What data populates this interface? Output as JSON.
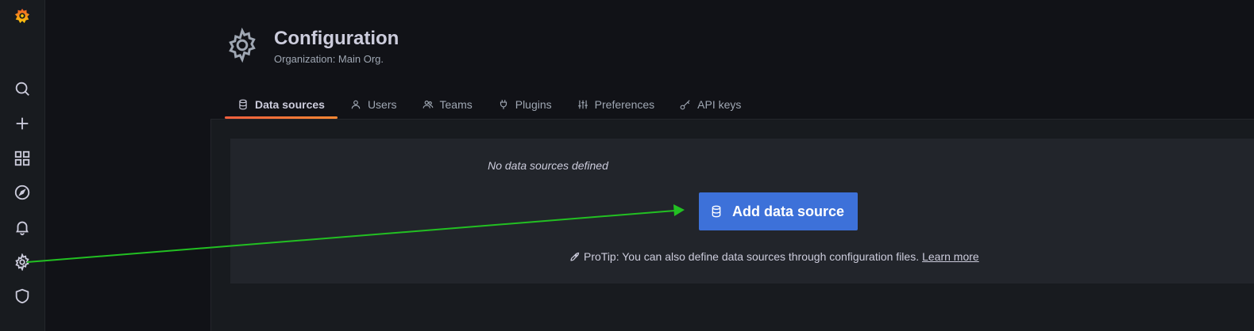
{
  "header": {
    "title": "Configuration",
    "subtitle": "Organization: Main Org."
  },
  "sidemenu": {
    "items": [
      {
        "icon": "grafana-logo-icon"
      },
      {
        "icon": "search-icon"
      },
      {
        "icon": "plus-icon"
      },
      {
        "icon": "dashboards-icon"
      },
      {
        "icon": "explore-compass-icon"
      },
      {
        "icon": "alerting-bell-icon"
      },
      {
        "icon": "configuration-gear-icon"
      },
      {
        "icon": "server-admin-shield-icon"
      }
    ]
  },
  "tabs": [
    {
      "label": "Data sources",
      "icon": "database-icon",
      "active": true
    },
    {
      "label": "Users",
      "icon": "user-icon",
      "active": false
    },
    {
      "label": "Teams",
      "icon": "users-icon",
      "active": false
    },
    {
      "label": "Plugins",
      "icon": "plug-icon",
      "active": false
    },
    {
      "label": "Preferences",
      "icon": "sliders-icon",
      "active": false
    },
    {
      "label": "API keys",
      "icon": "key-icon",
      "active": false
    }
  ],
  "empty_state": {
    "title": "No data sources defined",
    "button_label": "Add data source",
    "protip_text": "ProTip: You can also define data sources through configuration files.",
    "protip_link": "Learn more"
  },
  "colors": {
    "accent_tab": "#ff8833",
    "button": "#3d71d9",
    "annotation_arrow": "#22c022"
  }
}
